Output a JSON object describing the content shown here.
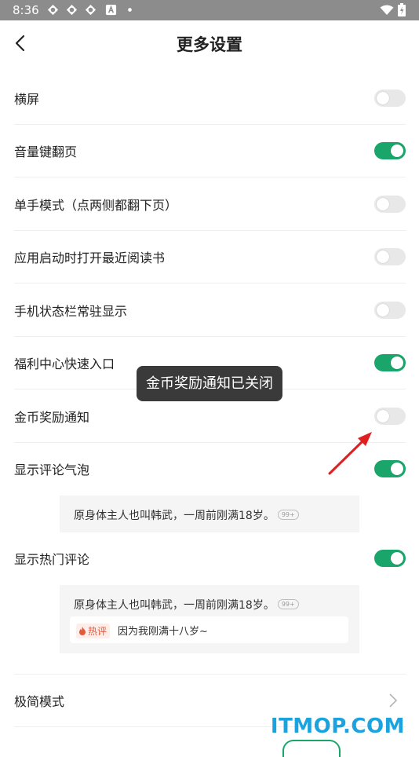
{
  "statusbar": {
    "time": "8:36",
    "icons": [
      "app-notification-icon",
      "app-notification-icon",
      "app-notification-icon",
      "a-notification-icon",
      "dot-icon"
    ],
    "right_icons": [
      "wifi-icon",
      "battery-icon"
    ]
  },
  "header": {
    "title": "更多设置",
    "back_icon": "chevron-left-icon"
  },
  "settings": [
    {
      "label": "横屏",
      "on": false
    },
    {
      "label": "音量键翻页",
      "on": true
    },
    {
      "label": "单手模式（点两侧都翻下页）",
      "on": false
    },
    {
      "label": "应用启动时打开最近阅读书",
      "on": false
    },
    {
      "label": "手机状态栏常驻显示",
      "on": false
    },
    {
      "label": "福利中心快速入口",
      "on": true
    },
    {
      "label": "金币奖励通知",
      "on": false
    },
    {
      "label": "显示评论气泡",
      "on": true
    },
    {
      "label": "显示热门评论",
      "on": true
    },
    {
      "label": "极简模式"
    }
  ],
  "bubble_preview": {
    "text": "原身体主人也叫韩武，一周前刚满18岁。",
    "badge": "99+"
  },
  "hot_preview": {
    "text": "原身体主人也叫韩武，一周前刚满18岁。",
    "badge": "99+",
    "hot_tag": "热评",
    "hot_text": "因为我刚满十八岁~"
  },
  "toast": {
    "text": "金币奖励通知已关闭"
  },
  "watermark": {
    "text": "ITMOP.COM"
  },
  "colors": {
    "accent": "#1aa66b",
    "switch_off": "#e8e8e8",
    "hot": "#e4583e",
    "watermark": "#1ba3e0",
    "annotation_arrow": "#e02020"
  }
}
